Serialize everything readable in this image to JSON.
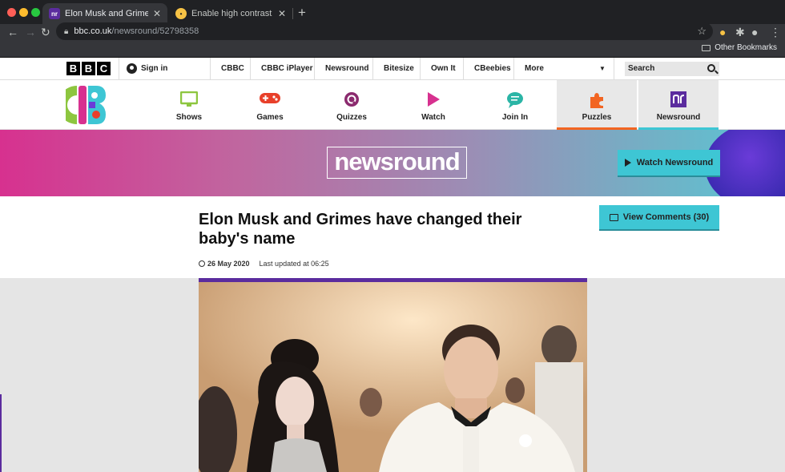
{
  "browser": {
    "tabs": [
      {
        "title": "Elon Musk and Grimes have ch",
        "favicon": "nr"
      },
      {
        "title": "Enable high contrast in Google",
        "favicon": ""
      }
    ],
    "url_host": "bbc.co.uk",
    "url_path": "/newsround/52798358",
    "other_bookmarks": "Other Bookmarks"
  },
  "bbc_header": {
    "logo_letters": [
      "B",
      "B",
      "C"
    ],
    "sign_in": "Sign in",
    "links": [
      "CBBC",
      "CBBC iPlayer",
      "Newsround",
      "Bitesize",
      "Own It",
      "CBeebies",
      "More"
    ],
    "search_placeholder": "Search"
  },
  "cbbc_nav": {
    "items": [
      {
        "label": "Shows",
        "icon": "tv-icon",
        "color": "#8dc63f"
      },
      {
        "label": "Games",
        "icon": "gamepad-icon",
        "color": "#e8402a"
      },
      {
        "label": "Quizzes",
        "icon": "quiz-icon",
        "color": "#8b2a6e"
      },
      {
        "label": "Watch",
        "icon": "play-icon",
        "color": "#d7318f"
      },
      {
        "label": "Join In",
        "icon": "chat-icon",
        "color": "#2bb5a6"
      },
      {
        "label": "Puzzles",
        "icon": "puzzle-icon",
        "color": "#f26522"
      },
      {
        "label": "Newsround",
        "icon": "newsround-icon",
        "color": "#5b2c9e"
      }
    ]
  },
  "banner": {
    "logo_text": "newsround",
    "watch_label": "Watch Newsround"
  },
  "article": {
    "headline": "Elon Musk and Grimes have changed their baby's name",
    "comments_label": "View Comments (30)",
    "date": "26 May 2020",
    "updated": "Last updated at 06:25"
  },
  "colors": {
    "accent_cyan": "#3ec6d4",
    "newsround_purple": "#5b2c9e",
    "puzzles_orange": "#f26522"
  }
}
